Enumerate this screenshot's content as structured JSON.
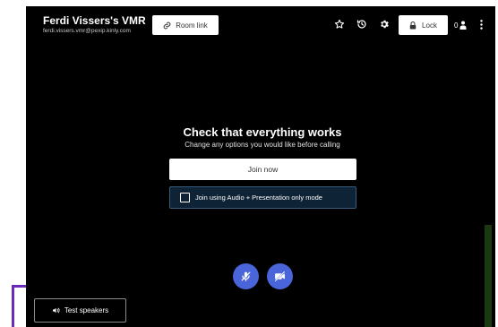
{
  "header": {
    "room_name": "Ferdi Vissers's VMR",
    "room_uri": "ferdi.vissers.vmr@pexip.kinly.com",
    "room_link_label": "Room link",
    "lock_label": "Lock",
    "participant_count": "0",
    "icons": [
      "link-icon",
      "star-icon",
      "history-icon",
      "gear-icon",
      "lock-icon",
      "person-icon",
      "kebab-menu-icon"
    ]
  },
  "main": {
    "heading": "Check that everything works",
    "subheading": "Change any options you would like before calling",
    "join_label": "Join now",
    "audio_only_label": "Join using Audio + Presentation only mode"
  },
  "controls": {
    "mic_icon": "mic-muted-icon",
    "camera_icon": "camera-off-icon",
    "accent_color": "#4a65d9"
  },
  "footer": {
    "test_speakers_label": "Test speakers",
    "highlight_color": "#6a2bb8"
  }
}
